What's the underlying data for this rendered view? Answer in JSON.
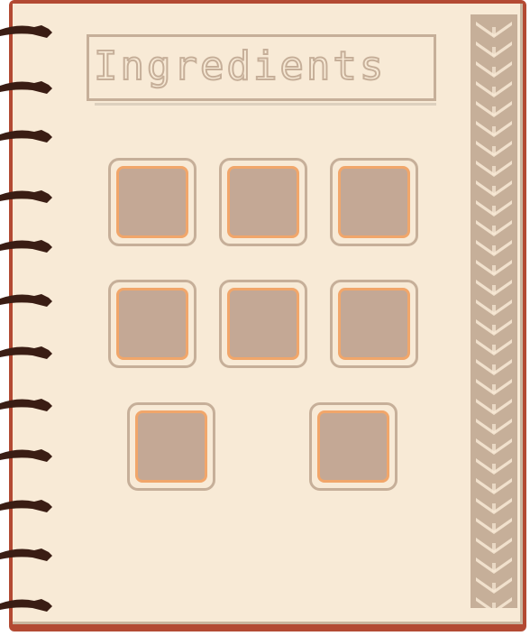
{
  "notebook": {
    "title": "Ingredients",
    "slot_count": 8,
    "colors": {
      "page": "#f8ead6",
      "cover": "#b34a33",
      "frame": "#c6af99",
      "slot_fill": "#c4a895",
      "slot_border": "#f1a66a",
      "ring": "#3a1d14"
    }
  }
}
